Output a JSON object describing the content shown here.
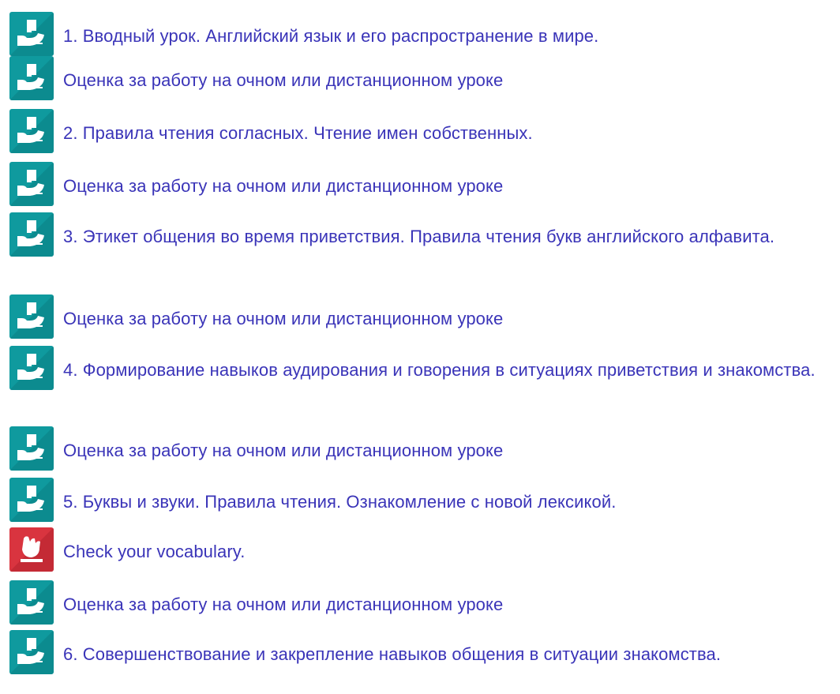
{
  "colors": {
    "link": "#3a34b8",
    "assignment_icon": "#0f9a9e",
    "quiz_icon": "#d9343f"
  },
  "items": [
    {
      "icon": "assignment-icon",
      "label": "1. Вводный урок. Английский язык и его распространение в мире."
    },
    {
      "icon": "assignment-icon",
      "label": "Оценка за работу на очном или дистанционном уроке"
    },
    {
      "icon": "assignment-icon",
      "label": "2. Правила чтения согласных. Чтение имен собственных."
    },
    {
      "icon": "assignment-icon",
      "label": "Оценка за работу на очном или дистанционном уроке"
    },
    {
      "icon": "assignment-icon",
      "label": "3. Этикет общения во время приветствия. Правила чтения букв английского алфавита."
    },
    {
      "icon": "assignment-icon",
      "label": "Оценка за работу на очном или дистанционном уроке"
    },
    {
      "icon": "assignment-icon",
      "label": "4. Формирование навыков аудирования и говорения в ситуациях приветствия и знакомства."
    },
    {
      "icon": "assignment-icon",
      "label": "Оценка за работу на очном или дистанционном уроке"
    },
    {
      "icon": "assignment-icon",
      "label": "5. Буквы и звуки. Правила чтения. Ознакомление с новой лексикой."
    },
    {
      "icon": "quiz-icon",
      "label": "Check your vocabulary."
    },
    {
      "icon": "assignment-icon",
      "label": "Оценка за работу на очном или дистанционном уроке"
    },
    {
      "icon": "assignment-icon",
      "label": "6. Совершенствование и закрепление навыков общения в ситуации знакомства."
    }
  ]
}
